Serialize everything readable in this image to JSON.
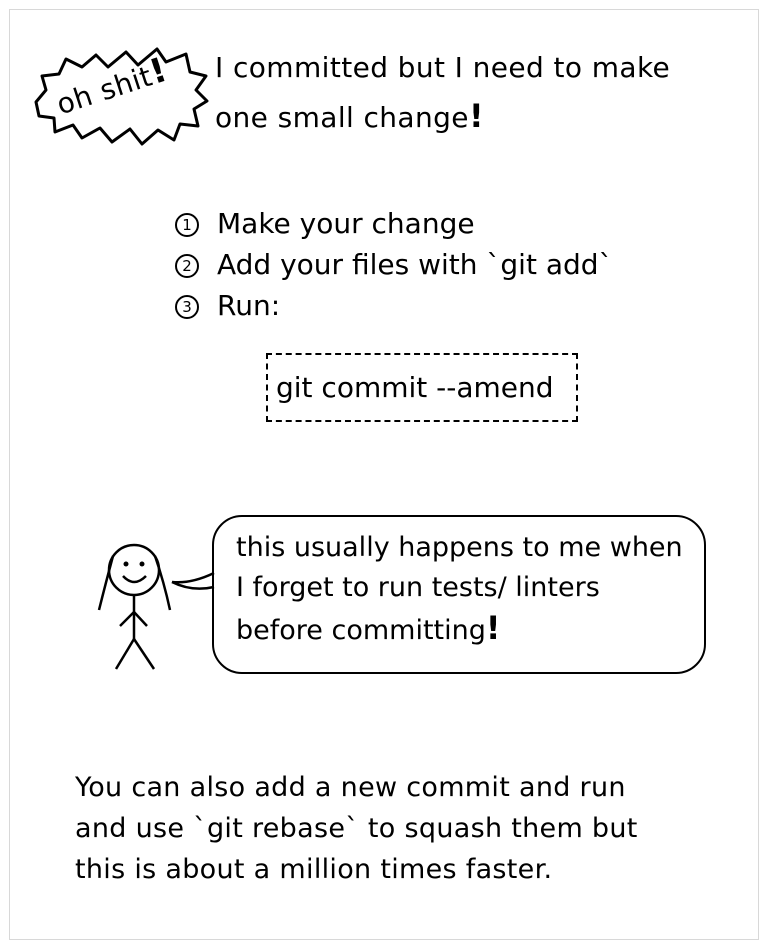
{
  "badge": {
    "text": "oh shit",
    "exclamation": "!"
  },
  "headline": {
    "line1": "I committed but I need to make",
    "line2": "one small change",
    "exclamation": "!"
  },
  "steps": [
    {
      "number": "1",
      "text": "Make your change"
    },
    {
      "number": "2",
      "text": "Add your files with `git add`"
    },
    {
      "number": "3",
      "text": "Run:"
    }
  ],
  "code": {
    "command": "git commit --amend"
  },
  "speech_bubble": {
    "line1": "this usually happens to me when",
    "line2": "I forget to run tests/ linters",
    "line3": "before committing",
    "exclamation": "!"
  },
  "footer": {
    "line1": "You can also add a new commit and run",
    "line2": "and use `git rebase` to squash them but",
    "line3": "this is about a million times faster."
  }
}
